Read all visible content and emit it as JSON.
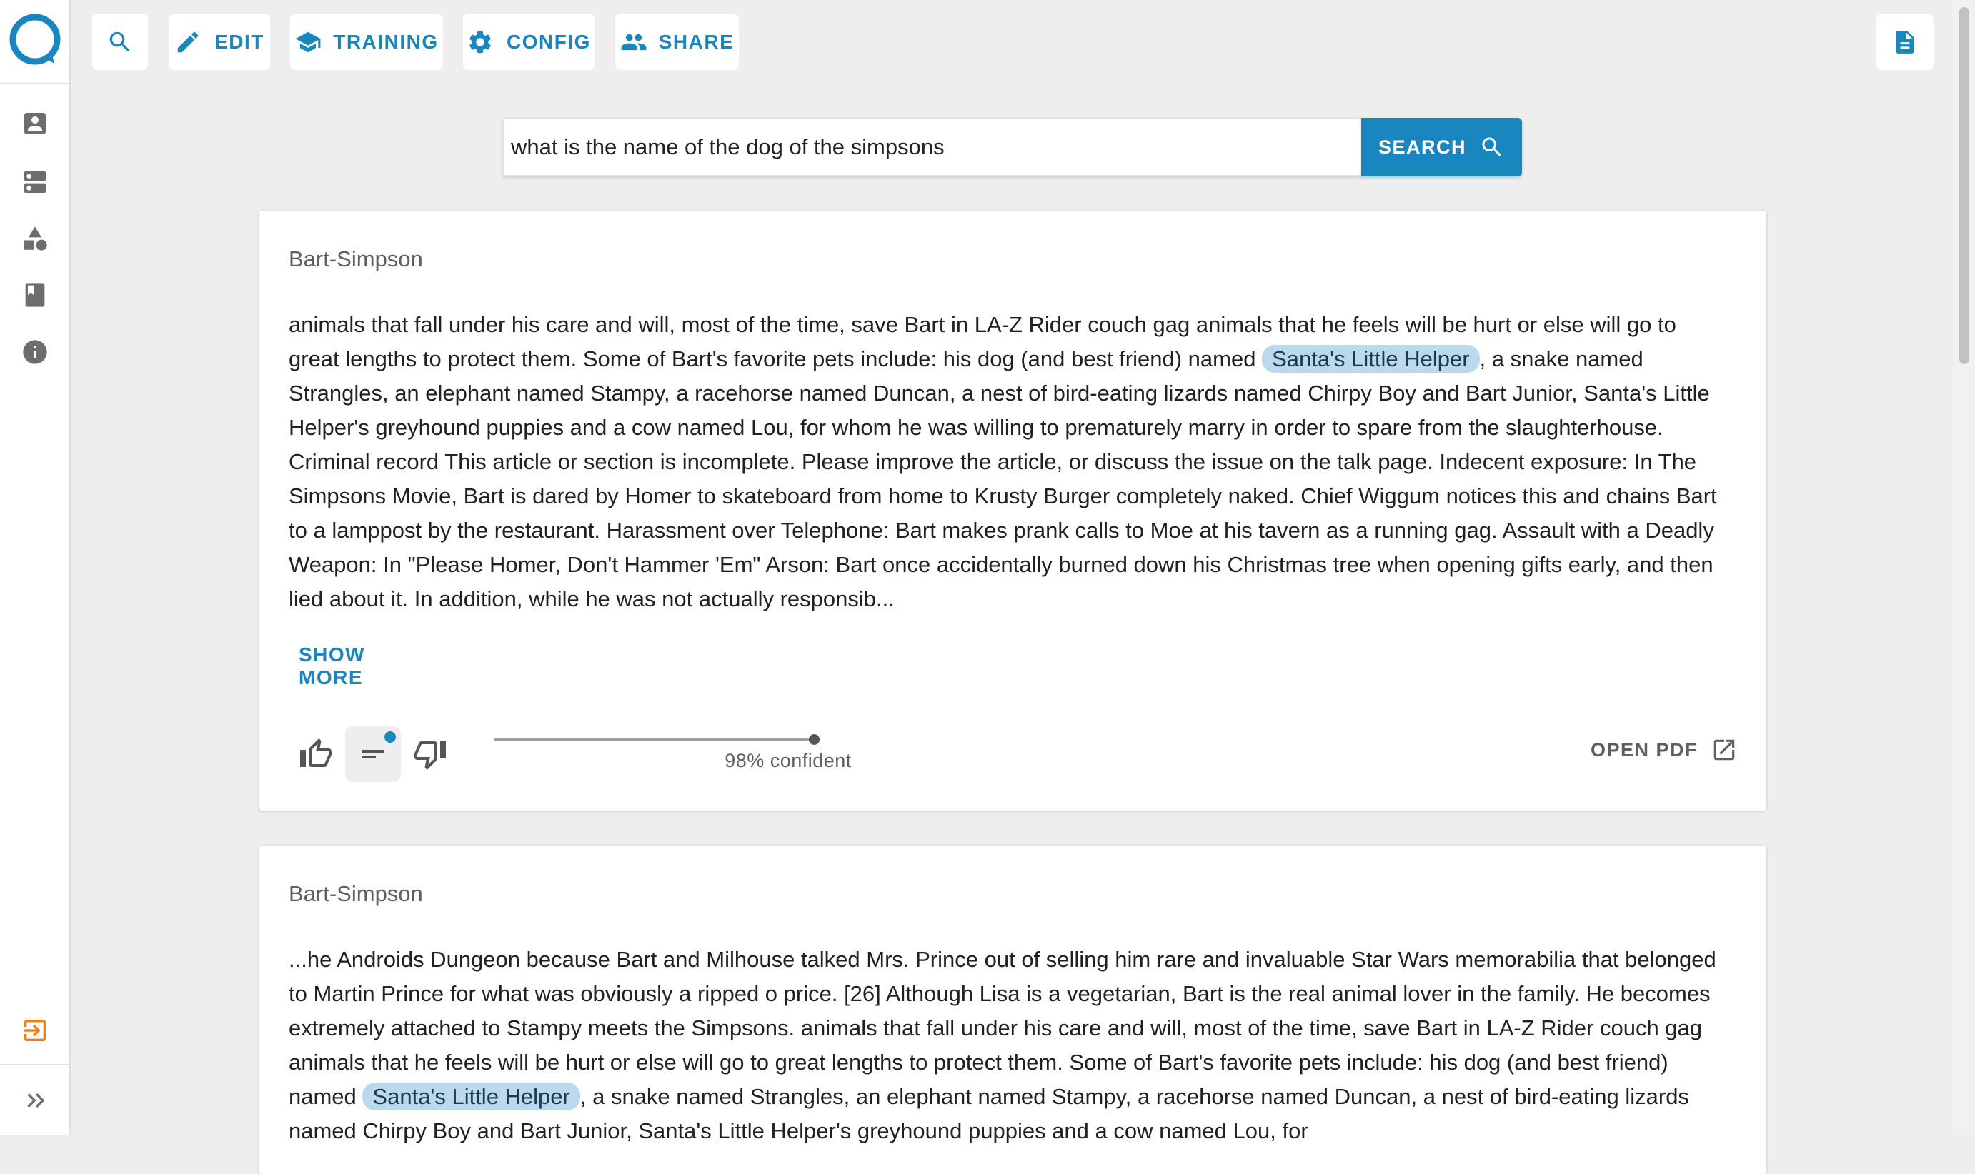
{
  "toolbar": {
    "edit_label": "EDIT",
    "training_label": "TRAINING",
    "config_label": "CONFIG",
    "share_label": "SHARE"
  },
  "search": {
    "query": "what is the name of the dog of the simpsons",
    "button_label": "SEARCH"
  },
  "sidebar": {
    "icons": [
      "account-box-icon",
      "dns-icon",
      "category-icon",
      "book-icon",
      "info-icon"
    ],
    "logout_icon": "logout-icon",
    "expand_icon": "double-chevron-right-icon"
  },
  "accent_color": "#1a86bf",
  "logout_color": "#e67e22",
  "results": [
    {
      "title": "Bart-Simpson",
      "text_before": "animals that fall under his care and will, most of the time, save Bart in LA-Z Rider couch gag animals that he feels will be hurt or else will go to great lengths to protect them. Some of Bart's favorite pets include: his dog (and best friend) named ",
      "highlight": "Santa's Little Helper",
      "text_after": ", a snake named Strangles, an elephant named Stampy, a racehorse named Duncan, a nest of bird-eating lizards named Chirpy Boy and Bart Junior, Santa's Little Helper's greyhound puppies and a cow named Lou, for whom he was willing to prematurely marry in order to spare from the slaughterhouse. Criminal record This article or section is incomplete. Please improve the article, or discuss the issue on the talk page. Indecent exposure: In The Simpsons Movie, Bart is dared by Homer to skateboard from home to Krusty Burger completely naked. Chief Wiggum notices this and chains Bart to a lamppost by the restaurant. Harassment over Telephone: Bart makes prank calls to Moe at his tavern as a running gag. Assault with a Deadly Weapon: In \"Please Homer, Don't Hammer 'Em\" Arson: Bart once accidentally burned down his Christmas tree when opening gifts early, and then lied about it. In addition, while he was not actually responsib...",
      "show_more_label": "SHOW MORE",
      "confidence": 0.98,
      "confidence_label": "98% confident",
      "open_pdf_label": "OPEN PDF"
    },
    {
      "title": "Bart-Simpson",
      "text_before": "...he Androids Dungeon because Bart and Milhouse talked Mrs. Prince out of selling him rare and invaluable Star Wars memorabilia that belonged to Martin Prince for what was obviously a ripped o price. [26] Although Lisa is a vegetarian, Bart is the real animal lover in the family. He becomes extremely attached to Stampy meets the Simpsons. animals that fall under his care and will, most of the time, save Bart in LA-Z Rider couch gag animals that he feels will be hurt or else will go to great lengths to protect them. Some of Bart's favorite pets include: his dog (and best friend) named ",
      "highlight": "Santa's Little Helper",
      "text_after": ", a snake named Strangles, an elephant named Stampy, a racehorse named Duncan, a nest of bird-eating lizards named Chirpy Boy and Bart Junior, Santa's Little Helper's greyhound puppies and a cow named Lou, for"
    }
  ]
}
